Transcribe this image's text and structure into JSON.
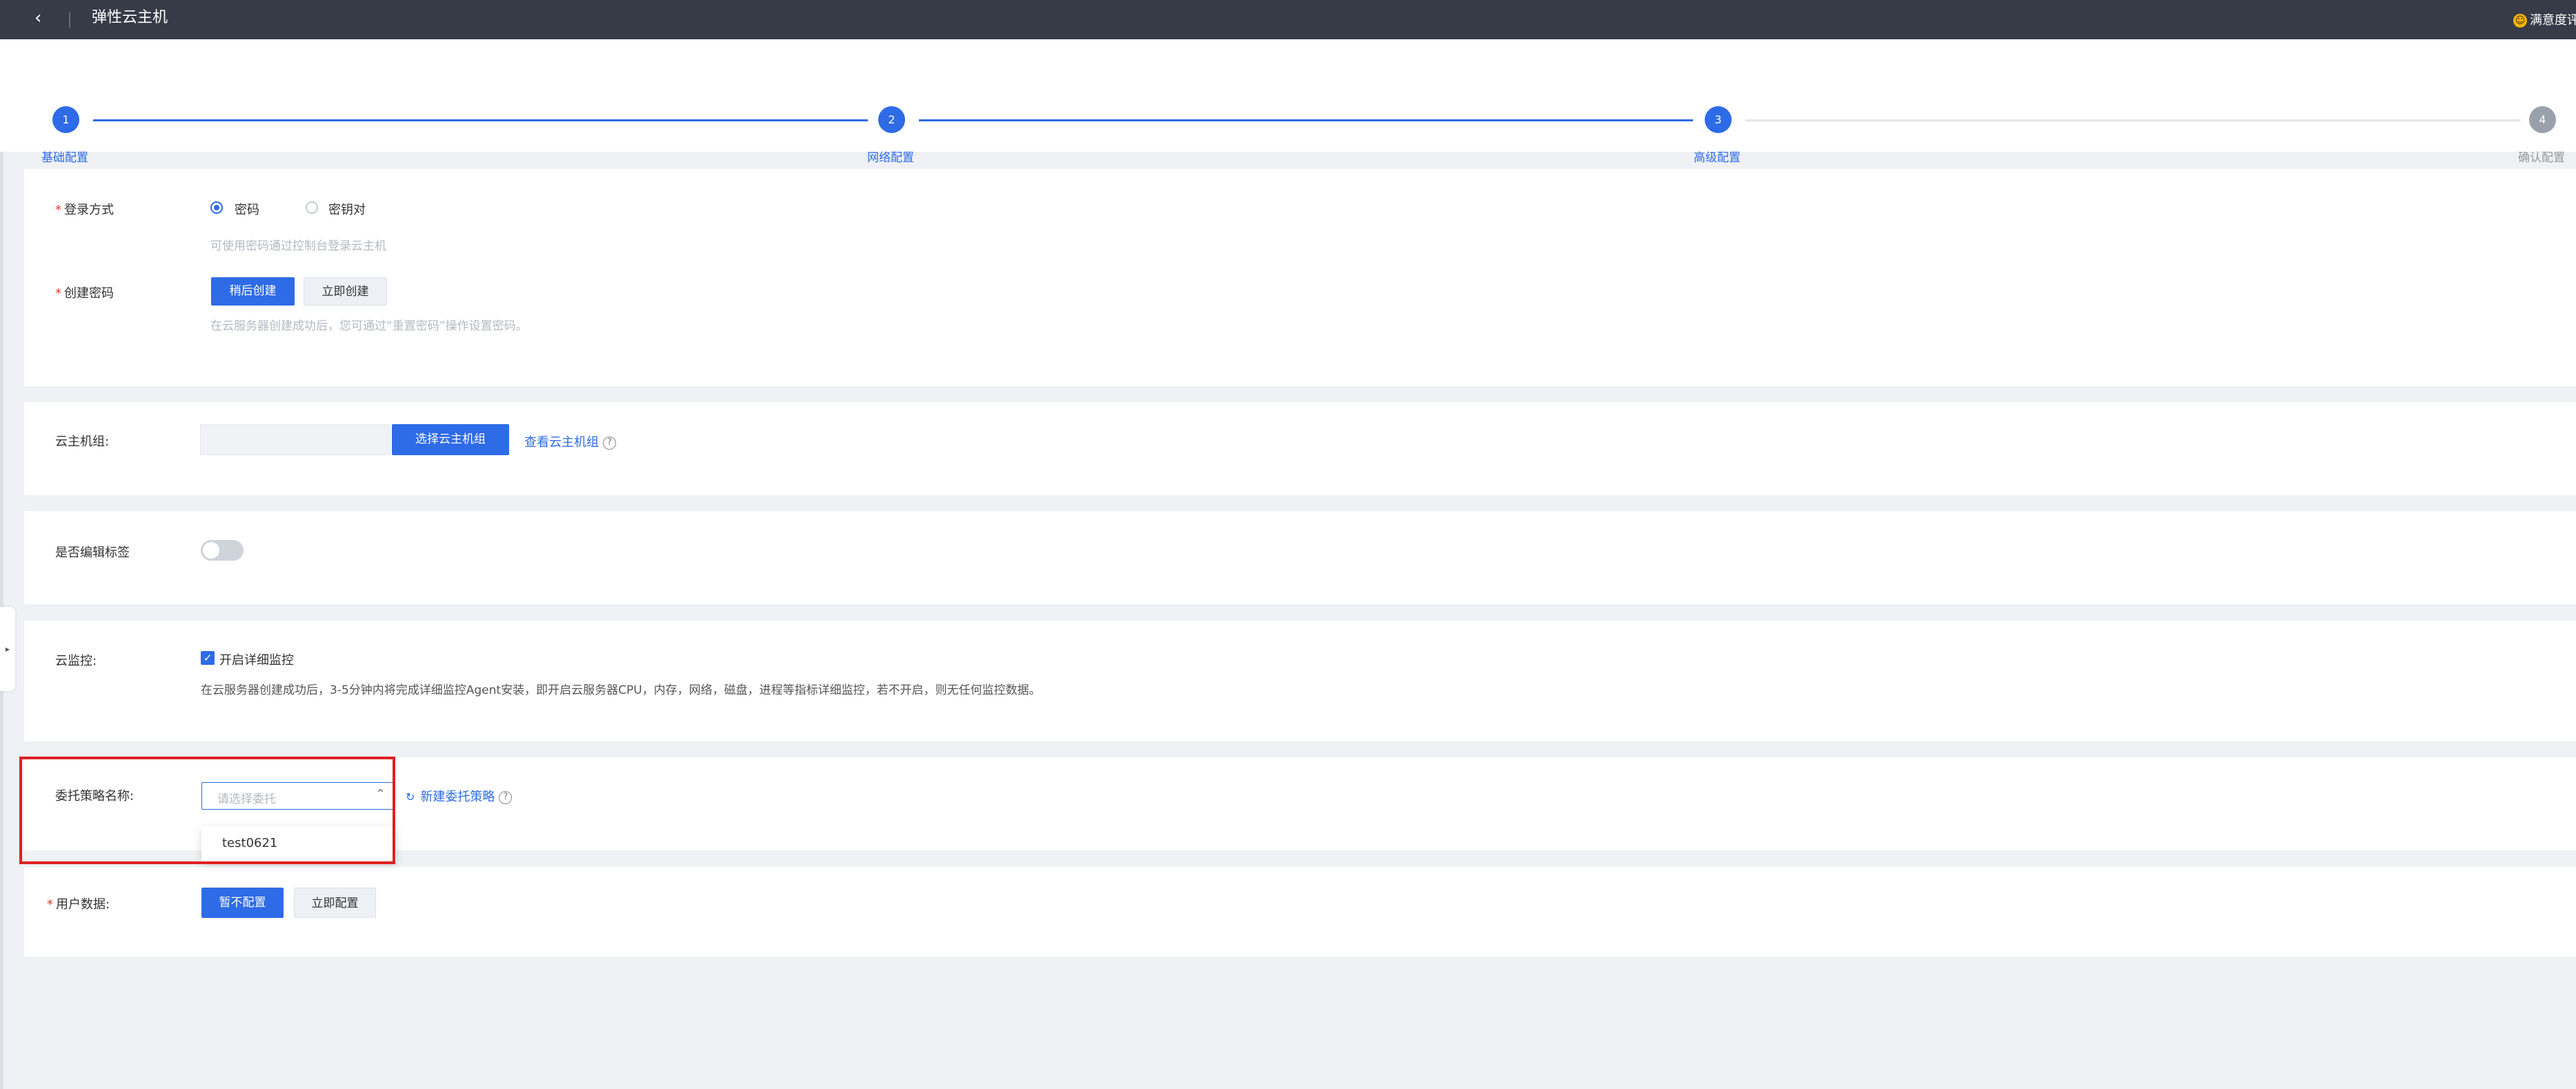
{
  "header": {
    "back_glyph": "‹",
    "title": "弹性云主机",
    "feedback_label": "满意度评"
  },
  "steps": [
    {
      "number": "1",
      "label": "基础配置",
      "status": "done"
    },
    {
      "number": "2",
      "label": "网络配置",
      "status": "done"
    },
    {
      "number": "3",
      "label": "高级配置",
      "status": "current"
    },
    {
      "number": "4",
      "label": "确认配置",
      "status": "pending"
    }
  ],
  "login": {
    "label": "登录方式",
    "options": [
      "密码",
      "密钥对"
    ],
    "selected": "密码",
    "hint": "可使用密码通过控制台登录云主机",
    "create_label": "创建密码",
    "create_later_button": "稍后创建",
    "create_now_button": "立即创建",
    "create_hint": "在云服务器创建成功后，您可通过“重置密码”操作设置密码。"
  },
  "host_group": {
    "label": "云主机组:",
    "input_value": "",
    "select_button": "选择云主机组",
    "view_link": "查看云主机组"
  },
  "tags": {
    "label": "是否编辑标签",
    "enabled": false
  },
  "monitor": {
    "label": "云监控:",
    "checkbox_label": "开启详细监控",
    "checked": true,
    "description": "在云服务器创建成功后，3-5分钟内将完成详细监控Agent安装，即开启云服务器CPU，内存，网络，磁盘，进程等指标详细监控，若不开启，则无任何监控数据。"
  },
  "delegation": {
    "label": "委托策略名称:",
    "placeholder": "请选择委托",
    "new_link": "新建委托策略",
    "options": [
      "test0621"
    ]
  },
  "user_data": {
    "label": "用户数据:",
    "no_config_button": "暂不配置",
    "config_now_button": "立即配置"
  },
  "colors": {
    "primary": "#2e6be6",
    "topbar": "#373b47",
    "highlight": "#e02020",
    "required": "#e03c31"
  }
}
